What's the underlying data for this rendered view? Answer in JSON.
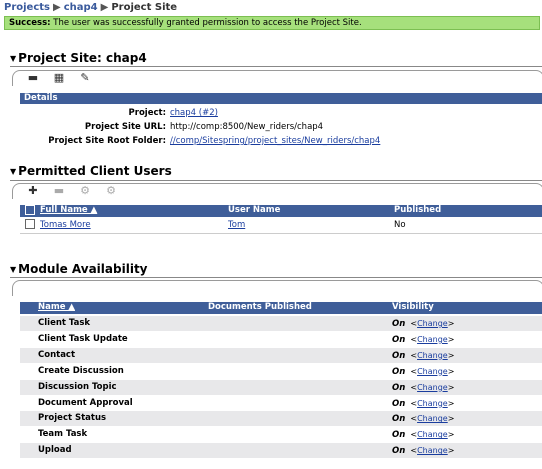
{
  "breadcrumb": {
    "items": [
      "Projects",
      "chap4",
      "Project Site"
    ],
    "sep": "▶"
  },
  "success": {
    "label": "Success:",
    "message": "The user was successfully granted permission to access the Project Site."
  },
  "project_site": {
    "title": "Project Site: chap4",
    "details_header": "Details",
    "fields": [
      {
        "label": "Project:",
        "value": "chap4 (#2)"
      },
      {
        "label": "Project Site URL:",
        "value": "http://comp:8500/New_riders/chap4"
      },
      {
        "label": "Project Site Root Folder:",
        "value": "//comp/Sitespring/project_sites/New_riders/chap4"
      }
    ]
  },
  "permitted": {
    "title": "Permitted Client Users",
    "columns": [
      "Full Name ▲",
      "User Name",
      "Published"
    ],
    "rows": [
      {
        "full_name": "Tomas More",
        "user_name": "Tom",
        "published": "No"
      }
    ]
  },
  "modules": {
    "title": "Module Availability",
    "columns": [
      "Name ▲",
      "Documents Published",
      "Visibility"
    ],
    "change_label": "Change",
    "rows": [
      {
        "name": "Client Task",
        "visibility": "On"
      },
      {
        "name": "Client Task Update",
        "visibility": "On"
      },
      {
        "name": "Contact",
        "visibility": "On"
      },
      {
        "name": "Create Discussion",
        "visibility": "On"
      },
      {
        "name": "Discussion Topic",
        "visibility": "On"
      },
      {
        "name": "Document Approval",
        "visibility": "On"
      },
      {
        "name": "Project Status",
        "visibility": "On"
      },
      {
        "name": "Team Task",
        "visibility": "On"
      },
      {
        "name": "Upload",
        "visibility": "On"
      }
    ]
  }
}
